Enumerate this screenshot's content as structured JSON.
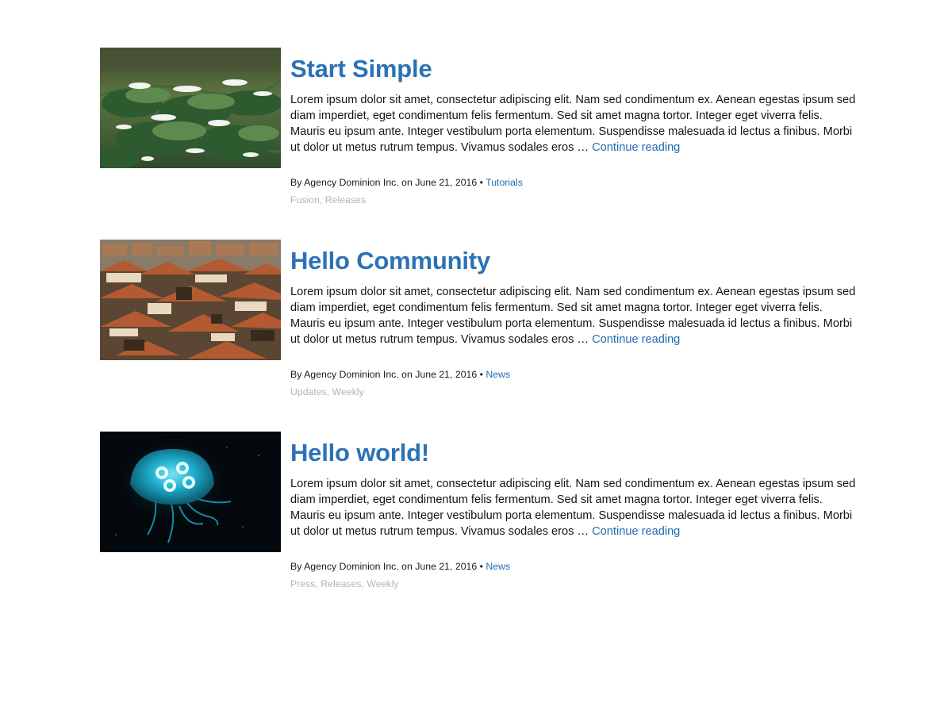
{
  "posts": [
    {
      "title": "Start Simple",
      "thumbnail": "pine-branches-snow",
      "excerpt": "Lorem ipsum dolor sit amet, consectetur adipiscing elit. Nam sed condimentum ex. Aenean egestas ipsum sed diam imperdiet, eget condimentum felis fermentum. Sed sit amet magna tortor. Integer eget viverra felis. Mauris eu ipsum ante. Integer vestibulum porta elementum. Suspendisse malesuada id lectus a finibus. Morbi ut dolor ut metus rutrum tempus. Vivamus sodales eros … ",
      "continue_label": "Continue reading",
      "byline_prefix": "By",
      "author": "Agency Dominion Inc.",
      "date_prefix": "on",
      "date": "June 21, 2016",
      "separator": "•",
      "category": "Tutorials",
      "tags": [
        "Fusion",
        "Releases"
      ]
    },
    {
      "title": "Hello Community",
      "thumbnail": "city-rooftops",
      "excerpt": "Lorem ipsum dolor sit amet, consectetur adipiscing elit. Nam sed condimentum ex. Aenean egestas ipsum sed diam imperdiet, eget condimentum felis fermentum. Sed sit amet magna tortor. Integer eget viverra felis. Mauris eu ipsum ante. Integer vestibulum porta elementum. Suspendisse malesuada id lectus a finibus. Morbi ut dolor ut metus rutrum tempus. Vivamus sodales eros … ",
      "continue_label": "Continue reading",
      "byline_prefix": "By",
      "author": "Agency Dominion Inc.",
      "date_prefix": "on",
      "date": "June 21, 2016",
      "separator": "•",
      "category": "News",
      "tags": [
        "Updates",
        "Weekly"
      ]
    },
    {
      "title": "Hello world!",
      "thumbnail": "jellyfish",
      "excerpt": "Lorem ipsum dolor sit amet, consectetur adipiscing elit. Nam sed condimentum ex. Aenean egestas ipsum sed diam imperdiet, eget condimentum felis fermentum. Sed sit amet magna tortor. Integer eget viverra felis. Mauris eu ipsum ante. Integer vestibulum porta elementum. Suspendisse malesuada id lectus a finibus. Morbi ut dolor ut metus rutrum tempus. Vivamus sodales eros … ",
      "continue_label": "Continue reading",
      "byline_prefix": "By",
      "author": "Agency Dominion Inc.",
      "date_prefix": "on",
      "date": "June 21, 2016",
      "separator": "•",
      "category": "News",
      "tags": [
        "Press",
        "Releases",
        "Weekly"
      ]
    }
  ],
  "colors": {
    "title_link": "#2a72b5",
    "link": "#1f6bb1",
    "body_text": "#141414",
    "tag_text": "#b5b5b5"
  }
}
